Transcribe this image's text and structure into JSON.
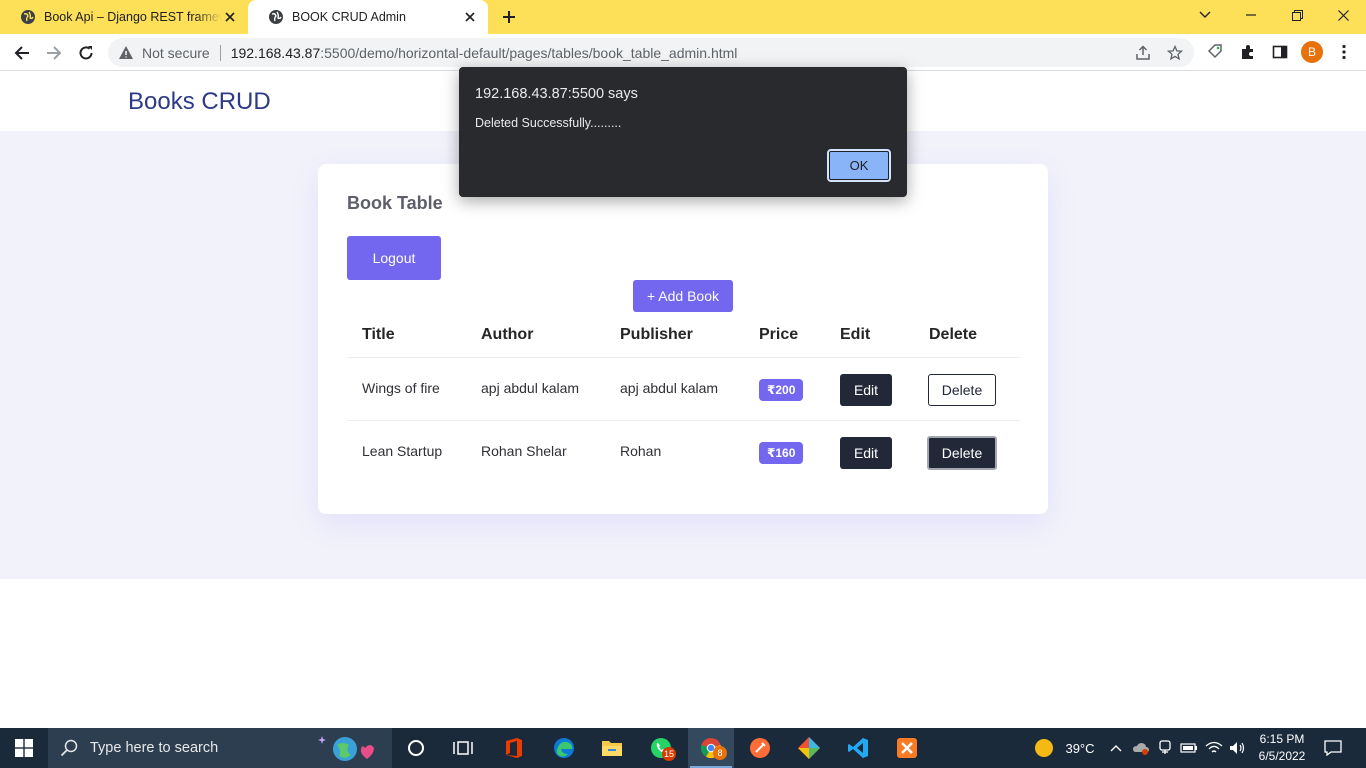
{
  "browser": {
    "tabs": [
      {
        "title": "Book Api – Django REST framewo",
        "active": false
      },
      {
        "title": "BOOK CRUD Admin",
        "active": true
      }
    ],
    "security_label": "Not secure",
    "url_host": "192.168.43.87",
    "url_rest": ":5500/demo/horizontal-default/pages/tables/book_table_admin.html",
    "profile_initial": "B",
    "colors": {
      "tabstrip": "#fddf58",
      "profile": "#e8710a"
    }
  },
  "app": {
    "brand": "Books CRUD",
    "card_title": "Book Table",
    "logout_label": "Logout",
    "add_book_label": "+ Add Book",
    "accent_color": "#7367f0",
    "dark_button_color": "#232838"
  },
  "table": {
    "headers": [
      "Title",
      "Author",
      "Publisher",
      "Price",
      "Edit",
      "Delete"
    ],
    "rows": [
      {
        "title": "Wings of fire",
        "author": "apj abdul kalam",
        "publisher": "apj abdul kalam",
        "price": "₹200",
        "edit": "Edit",
        "delete": "Delete"
      },
      {
        "title": "Lean Startup",
        "author": "Rohan Shelar",
        "publisher": "Rohan",
        "price": "₹160",
        "edit": "Edit",
        "delete": "Delete"
      }
    ]
  },
  "dialog": {
    "title": "192.168.43.87:5500 says",
    "message": "Deleted Successfully.........",
    "ok_label": "OK"
  },
  "taskbar": {
    "search_placeholder": "Type here to search",
    "whatsapp_badge": "15",
    "chrome_badge": "8",
    "temperature": "39°C",
    "time": "6:15 PM",
    "date": "6/5/2022"
  }
}
